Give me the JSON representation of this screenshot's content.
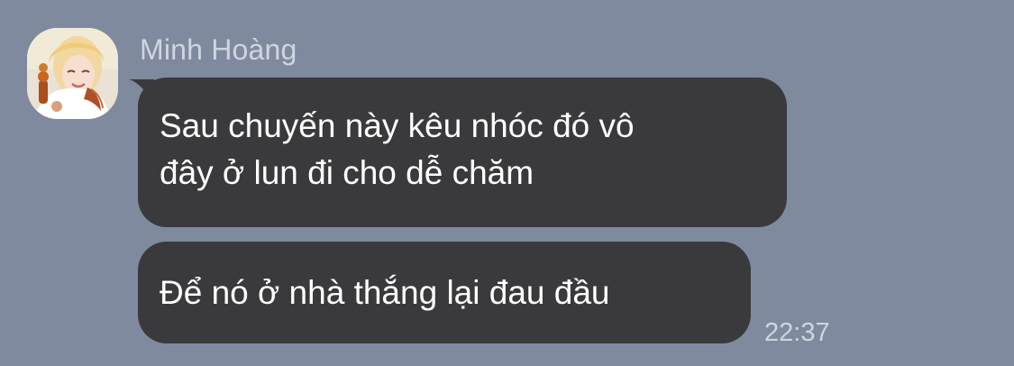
{
  "chat": {
    "sender_name": "Minh Hoàng",
    "avatar_icon": "avatar-photo",
    "messages": [
      {
        "lines": [
          "Sau chuyến này kêu nhóc đó vô",
          "đây ở lun đi cho dễ chăm"
        ]
      },
      {
        "lines": [
          "Để nó ở nhà thắng lại đau đầu"
        ]
      }
    ],
    "timestamp": "22:37"
  },
  "colors": {
    "background": "#7f8a9e",
    "bubble": "#3a3a3c",
    "bubble_text": "#ffffff",
    "meta_text": "#cfd5e0"
  }
}
